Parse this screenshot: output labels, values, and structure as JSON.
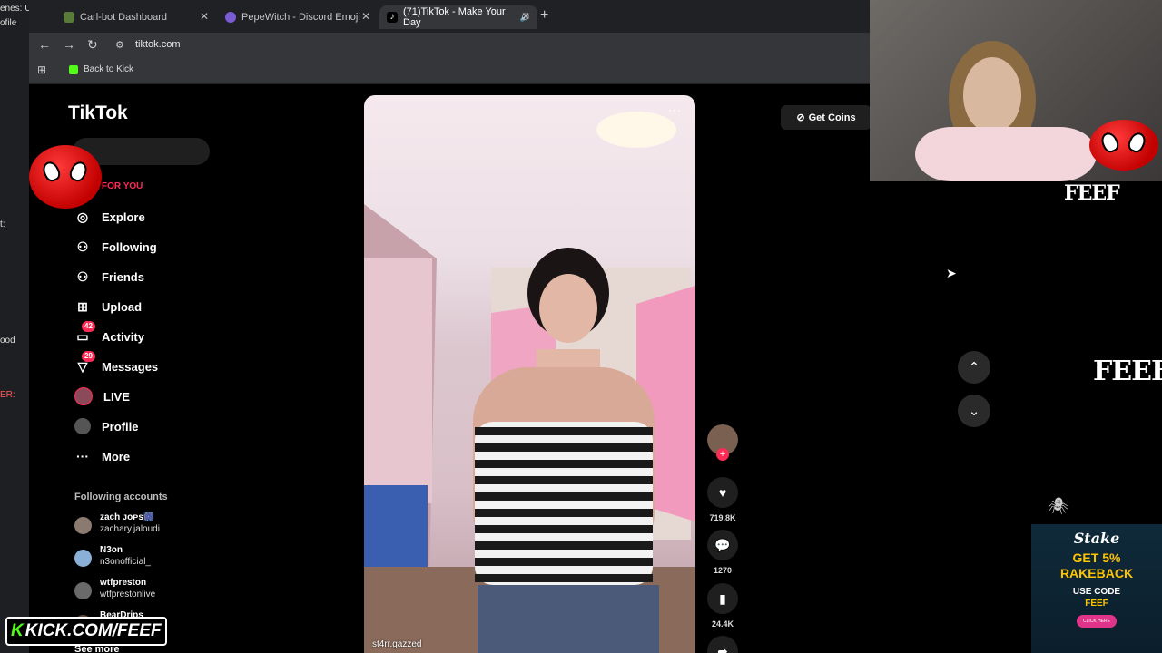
{
  "discord_strip": {
    "fragments": [
      "enes: U",
      "ofile",
      "t:",
      "ood",
      "ER:"
    ]
  },
  "browser": {
    "tabs": [
      {
        "title": "Carl-bot Dashboard",
        "active": false
      },
      {
        "title": "PepeWitch - Discord Emoji",
        "active": false
      },
      {
        "title": "(71)TikTok - Make Your Day",
        "active": true
      }
    ],
    "address": "tiktok.com",
    "bookmark": "Back to Kick"
  },
  "tiktok": {
    "logo": "TikTok",
    "for_you": "FOR YOU",
    "nav": [
      {
        "label": "Explore",
        "icon": "explore-icon",
        "glyph": "◎"
      },
      {
        "label": "Following",
        "icon": "following-icon",
        "glyph": "⚇"
      },
      {
        "label": "Friends",
        "icon": "friends-icon",
        "glyph": "⚇"
      },
      {
        "label": "Upload",
        "icon": "upload-icon",
        "glyph": "⊞"
      },
      {
        "label": "Activity",
        "icon": "activity-icon",
        "glyph": "▭",
        "badge": "42"
      },
      {
        "label": "Messages",
        "icon": "messages-icon",
        "glyph": "▽",
        "badge": "29"
      },
      {
        "label": "LIVE",
        "icon": "live-icon",
        "glyph": "●"
      },
      {
        "label": "Profile",
        "icon": "profile-icon",
        "glyph": "●"
      },
      {
        "label": "More",
        "icon": "more-icon",
        "glyph": "···"
      }
    ],
    "following_title": "Following accounts",
    "accounts": [
      {
        "name": "zach ᴊᴏᴘs🎆",
        "handle": "zachary.jaloudi"
      },
      {
        "name": "N3on",
        "handle": "n3onofficial_"
      },
      {
        "name": "wtfpreston",
        "handle": "wtfprestonlive"
      },
      {
        "name": "BearDrips",
        "handle": ""
      }
    ],
    "see_more": "See more",
    "video_author": "st4rr.gazzed",
    "actions": {
      "likes": "719.8K",
      "comments": "1270",
      "saves": "24.4K"
    },
    "get_coins": "Get Coins"
  },
  "overlay": {
    "feef": "FEEF",
    "stake": {
      "logo": "Stake",
      "line1": "GET 5%",
      "line2": "RAKEBACK",
      "code_label": "USE CODE",
      "code": "FEEF",
      "button": "CLICK HERE"
    },
    "kick_url": "KICK.COM/FEEF",
    "kick_letter": "K"
  }
}
